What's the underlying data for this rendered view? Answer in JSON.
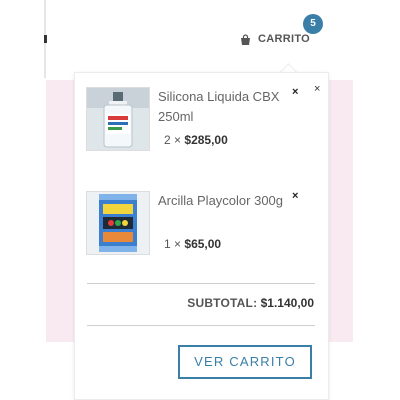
{
  "header": {
    "cart_label": "CARRITO",
    "cart_count": "5"
  },
  "mini_cart": {
    "items": [
      {
        "name": "Silicona Liquida CBX 250ml",
        "quantity": "2",
        "price": "$285,00",
        "thumb_icon": "silicone-bottle-icon"
      },
      {
        "name": "Arcilla Playcolor 300g",
        "quantity": "1",
        "price": "$65,00",
        "thumb_icon": "clay-package-icon"
      }
    ],
    "remove_symbol": "×",
    "times_symbol": "×",
    "subtotal_label": "SUBTOTAL:",
    "subtotal_value": "$1.140,00",
    "view_cart_label": "VER CARRITO"
  },
  "colors": {
    "accent": "#3a7fa8",
    "pink_band": "#f9eaf1"
  }
}
